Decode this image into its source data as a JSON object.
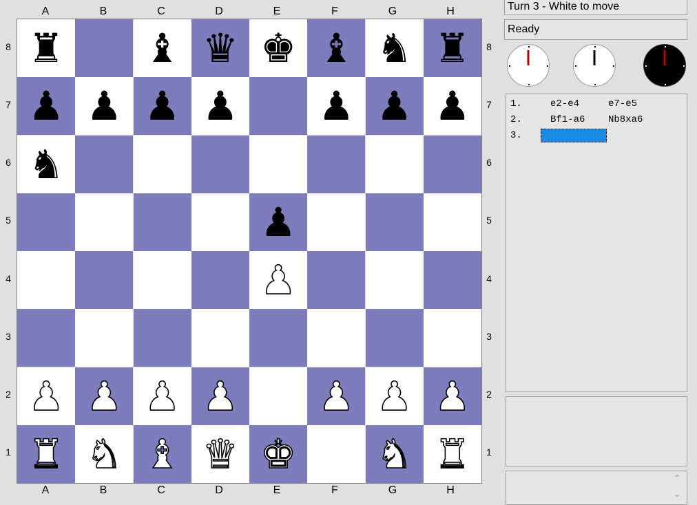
{
  "files": [
    "A",
    "B",
    "C",
    "D",
    "E",
    "F",
    "G",
    "H"
  ],
  "ranks": [
    "8",
    "7",
    "6",
    "5",
    "4",
    "3",
    "2",
    "1"
  ],
  "board": [
    [
      {
        "color": "black",
        "glyph": "♜",
        "name": "rook"
      },
      null,
      {
        "color": "black",
        "glyph": "♝",
        "name": "bishop"
      },
      {
        "color": "black",
        "glyph": "♛",
        "name": "queen"
      },
      {
        "color": "black",
        "glyph": "♚",
        "name": "king"
      },
      {
        "color": "black",
        "glyph": "♝",
        "name": "bishop"
      },
      {
        "color": "black",
        "glyph": "♞",
        "name": "knight"
      },
      {
        "color": "black",
        "glyph": "♜",
        "name": "rook"
      }
    ],
    [
      {
        "color": "black",
        "glyph": "♟",
        "name": "pawn"
      },
      {
        "color": "black",
        "glyph": "♟",
        "name": "pawn"
      },
      {
        "color": "black",
        "glyph": "♟",
        "name": "pawn"
      },
      {
        "color": "black",
        "glyph": "♟",
        "name": "pawn"
      },
      null,
      {
        "color": "black",
        "glyph": "♟",
        "name": "pawn"
      },
      {
        "color": "black",
        "glyph": "♟",
        "name": "pawn"
      },
      {
        "color": "black",
        "glyph": "♟",
        "name": "pawn"
      }
    ],
    [
      {
        "color": "black",
        "glyph": "♞",
        "name": "knight"
      },
      null,
      null,
      null,
      null,
      null,
      null,
      null
    ],
    [
      null,
      null,
      null,
      null,
      {
        "color": "black",
        "glyph": "♟",
        "name": "pawn"
      },
      null,
      null,
      null
    ],
    [
      null,
      null,
      null,
      null,
      {
        "color": "white",
        "glyph": "♟",
        "name": "pawn"
      },
      null,
      null,
      null
    ],
    [
      null,
      null,
      null,
      null,
      null,
      null,
      null,
      null
    ],
    [
      {
        "color": "white",
        "glyph": "♟",
        "name": "pawn"
      },
      {
        "color": "white",
        "glyph": "♟",
        "name": "pawn"
      },
      {
        "color": "white",
        "glyph": "♟",
        "name": "pawn"
      },
      {
        "color": "white",
        "glyph": "♟",
        "name": "pawn"
      },
      null,
      {
        "color": "white",
        "glyph": "♟",
        "name": "pawn"
      },
      {
        "color": "white",
        "glyph": "♟",
        "name": "pawn"
      },
      {
        "color": "white",
        "glyph": "♟",
        "name": "pawn"
      }
    ],
    [
      {
        "color": "white",
        "glyph": "♜",
        "name": "rook"
      },
      {
        "color": "white",
        "glyph": "♞",
        "name": "knight"
      },
      {
        "color": "white",
        "glyph": "♝",
        "name": "bishop"
      },
      {
        "color": "white",
        "glyph": "♛",
        "name": "queen"
      },
      {
        "color": "white",
        "glyph": "♚",
        "name": "king"
      },
      null,
      {
        "color": "white",
        "glyph": "♞",
        "name": "knight"
      },
      {
        "color": "white",
        "glyph": "♜",
        "name": "rook"
      }
    ]
  ],
  "colors": {
    "light_square": "#ffffff",
    "dark_square": "#7d7cbc",
    "selected_move": "#1a8be3"
  },
  "status": {
    "turn_text": "Turn 3 - White to move",
    "ready_text": "Ready"
  },
  "clocks": [
    {
      "face": "light",
      "hand": "red"
    },
    {
      "face": "light",
      "hand": "black"
    },
    {
      "face": "dark",
      "hand": "red"
    }
  ],
  "moves": [
    {
      "num": "1.",
      "white": "e2-e4",
      "black": "e7-e5"
    },
    {
      "num": "2.",
      "white": "Bf1-a6",
      "black": "Nb8xa6"
    },
    {
      "num": "3.",
      "white": "",
      "black": ""
    }
  ],
  "scroll": {
    "up": "⌃",
    "down": "⌄"
  }
}
